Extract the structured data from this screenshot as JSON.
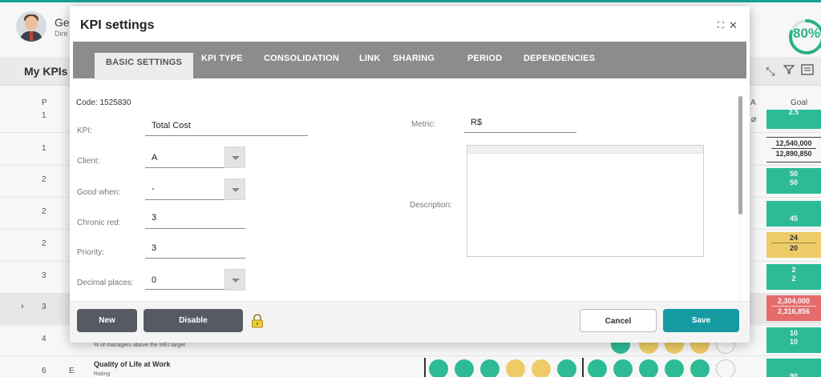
{
  "background": {
    "user": {
      "name": "Ge",
      "role": "Dire"
    },
    "progress": {
      "text": "80%",
      "value": 0.8
    },
    "toolbar": {
      "title": "My KPIs |"
    },
    "columns": {
      "p": "P",
      "a": "A",
      "goal": "Goal"
    },
    "rows": [
      {
        "p": "1",
        "goal": "2.5"
      },
      {
        "p": "1",
        "goal_top": "12,540,000",
        "goal_bottom": "12,890,850"
      },
      {
        "p": "2",
        "goal_top": "50",
        "goal_bottom": "50"
      },
      {
        "p": "2",
        "goal": "45"
      },
      {
        "p": "2",
        "goal_top": "24",
        "goal_bottom": "20"
      },
      {
        "p": "3",
        "goal_top": "2",
        "goal_bottom": "2"
      },
      {
        "p": "3",
        "goal_top": "2,304,000",
        "goal_bottom": "2,316,856"
      },
      {
        "p": "4",
        "goal_top": "10",
        "goal_bottom": "10",
        "sub": "% of managers above the MEI target"
      },
      {
        "p": "6",
        "e": "E",
        "title": "Quality of Life at Work",
        "sub": "Rating",
        "goal": "90"
      }
    ]
  },
  "modal": {
    "title": "KPI settings",
    "tabs": [
      "BASIC SETTINGS",
      "KPI TYPE",
      "CONSOLIDATION",
      "LINK",
      "SHARING",
      "PERIOD",
      "DEPENDENCIES"
    ],
    "code": "Code: 1525830",
    "fields": {
      "kpi": {
        "label": "KPI:",
        "value": "Total Cost"
      },
      "client": {
        "label": "Client:",
        "value": "A"
      },
      "good_when": {
        "label": "Good when:",
        "value": "-"
      },
      "chronic_red": {
        "label": "Chronic red:",
        "value": "3"
      },
      "priority": {
        "label": "Priority:",
        "value": "3"
      },
      "decimal_places": {
        "label": "Decimal places:",
        "value": "0"
      },
      "metric": {
        "label": "Metric:",
        "value": "R$"
      },
      "description": {
        "label": "Description:",
        "value": ""
      }
    },
    "buttons": {
      "new": "New",
      "disable": "Disable",
      "cancel": "Cancel",
      "save": "Save"
    }
  }
}
